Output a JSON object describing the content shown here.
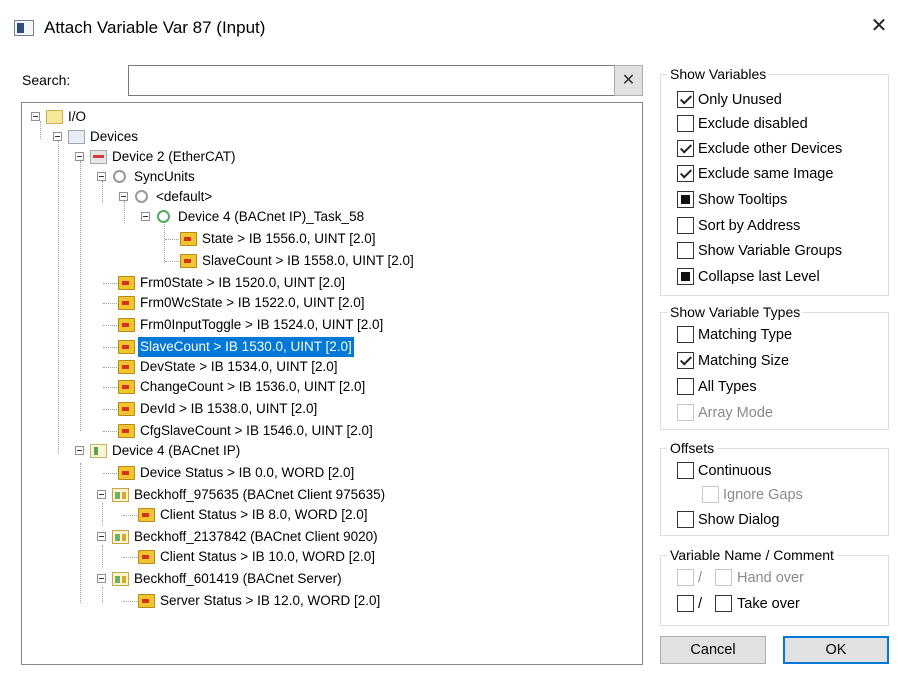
{
  "window": {
    "title": "Attach Variable Var 87 (Input)",
    "close_glyph": "✕"
  },
  "search": {
    "label": "Search:",
    "value": "",
    "clear_glyph": "✕"
  },
  "tree": [
    {
      "label": "I/O"
    },
    {
      "label": "Devices"
    },
    {
      "label": "Device 2 (EtherCAT)"
    },
    {
      "label": "SyncUnits"
    },
    {
      "label": "<default>"
    },
    {
      "label": "Device 4 (BACnet IP)_Task_58"
    },
    {
      "label": "State  >  IB 1556.0, UINT [2.0]"
    },
    {
      "label": "SlaveCount  >  IB 1558.0, UINT [2.0]"
    },
    {
      "label": "Frm0State  >  IB 1520.0, UINT [2.0]"
    },
    {
      "label": "Frm0WcState  >  IB 1522.0, UINT [2.0]"
    },
    {
      "label": "Frm0InputToggle  >  IB 1524.0, UINT [2.0]"
    },
    {
      "label": "SlaveCount  >  IB 1530.0, UINT [2.0]",
      "selected": true
    },
    {
      "label": "DevState  >  IB 1534.0, UINT [2.0]"
    },
    {
      "label": "ChangeCount  >  IB 1536.0, UINT [2.0]"
    },
    {
      "label": "DevId  >  IB 1538.0, UINT [2.0]"
    },
    {
      "label": "CfgSlaveCount  >  IB 1546.0, UINT [2.0]"
    },
    {
      "label": "Device 4 (BACnet IP)"
    },
    {
      "label": "Device Status  >  IB 0.0, WORD [2.0]"
    },
    {
      "label": "Beckhoff_975635 (BACnet Client 975635)"
    },
    {
      "label": "Client Status  >  IB 8.0, WORD [2.0]"
    },
    {
      "label": "Beckhoff_2137842 (BACnet Client 9020)"
    },
    {
      "label": "Client Status  >  IB 10.0, WORD [2.0]"
    },
    {
      "label": "Beckhoff_601419 (BACnet Server)"
    },
    {
      "label": "Server Status  >  IB 12.0, WORD [2.0]"
    }
  ],
  "show_variables": {
    "title": "Show Variables",
    "options": [
      {
        "label": "Only Unused",
        "state": "checked"
      },
      {
        "label": "Exclude disabled",
        "state": "unchecked"
      },
      {
        "label": "Exclude other Devices",
        "state": "checked"
      },
      {
        "label": "Exclude same Image",
        "state": "checked"
      },
      {
        "label": "Show Tooltips",
        "state": "indeterminate"
      },
      {
        "label": "Sort by Address",
        "state": "unchecked"
      },
      {
        "label": "Show Variable Groups",
        "state": "unchecked"
      },
      {
        "label": "Collapse last Level",
        "state": "indeterminate"
      }
    ]
  },
  "show_variable_types": {
    "title": "Show Variable Types",
    "options": [
      {
        "label": "Matching Type",
        "state": "unchecked"
      },
      {
        "label": "Matching Size",
        "state": "checked"
      },
      {
        "label": "All Types",
        "state": "unchecked"
      },
      {
        "label": "Array Mode",
        "state": "disabled"
      }
    ]
  },
  "offsets": {
    "title": "Offsets",
    "options": [
      {
        "label": "Continuous",
        "state": "unchecked"
      },
      {
        "label": "Ignore Gaps",
        "state": "disabled"
      },
      {
        "label": "Show Dialog",
        "state": "unchecked"
      }
    ]
  },
  "variable_name": {
    "title": "Variable Name / Comment",
    "separator": "/",
    "hand_over_label": "Hand over",
    "take_over_label": "Take over"
  },
  "buttons": {
    "cancel": "Cancel",
    "ok": "OK"
  }
}
